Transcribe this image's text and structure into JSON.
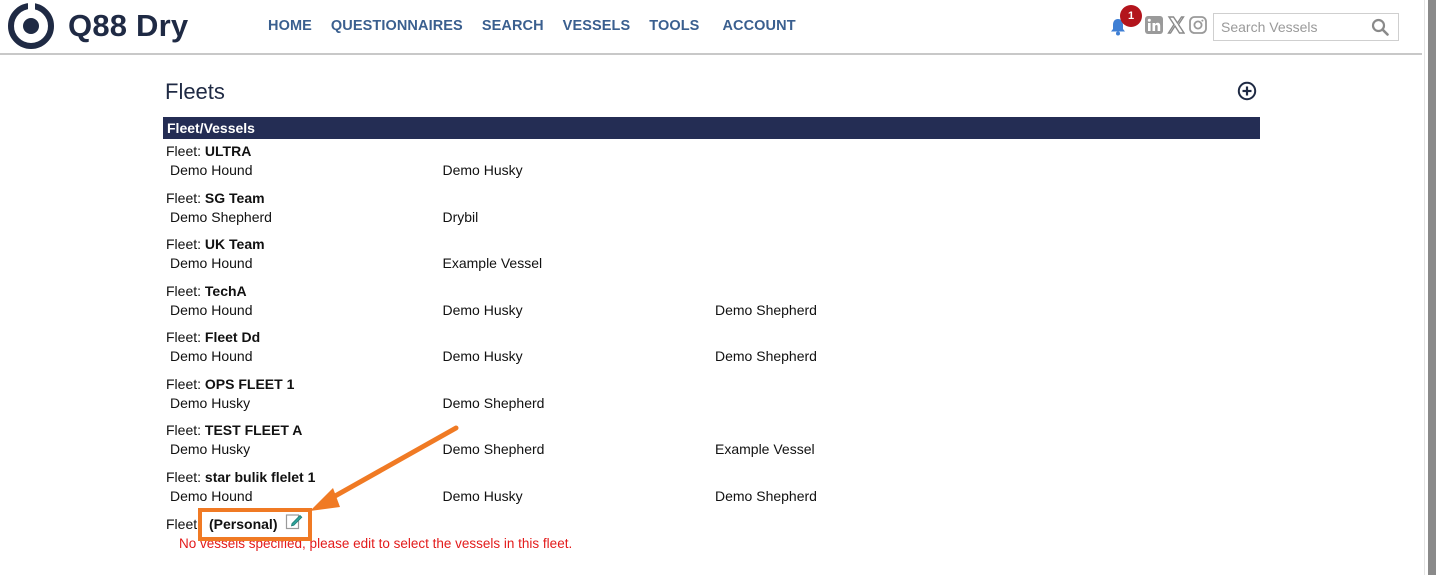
{
  "brand": {
    "name": "Q88 Dry"
  },
  "nav": {
    "items": [
      "HOME",
      "QUESTIONNAIRES",
      "SEARCH",
      "VESSELS",
      "TOOLS",
      "ACCOUNT"
    ]
  },
  "notifications": {
    "count": "1"
  },
  "search": {
    "placeholder": "Search Vessels"
  },
  "page": {
    "title": "Fleets",
    "table_header": "Fleet/Vessels"
  },
  "fleet_label": "Fleet:",
  "fleets": [
    {
      "name": "ULTRA",
      "vessels": [
        "Demo Hound",
        "Demo Husky"
      ]
    },
    {
      "name": "SG Team",
      "vessels": [
        "Demo Shepherd",
        "Drybil"
      ]
    },
    {
      "name": "UK Team",
      "vessels": [
        "Demo Hound",
        "Example Vessel"
      ]
    },
    {
      "name": "TechA",
      "vessels": [
        "Demo Hound",
        "Demo Husky",
        "Demo Shepherd"
      ]
    },
    {
      "name": "Fleet Dd",
      "vessels": [
        "Demo Hound",
        "Demo Husky",
        "Demo Shepherd"
      ]
    },
    {
      "name": "OPS FLEET 1",
      "vessels": [
        "Demo Husky",
        "Demo Shepherd"
      ]
    },
    {
      "name": "TEST FLEET A",
      "vessels": [
        "Demo Husky",
        "Demo Shepherd",
        "Example Vessel"
      ]
    },
    {
      "name": "star bulik flelet 1",
      "vessels": [
        "Demo Hound",
        "Demo Husky",
        "Demo Shepherd"
      ]
    }
  ],
  "personal_fleet": {
    "label": "Fleet:",
    "name": "(Personal)",
    "message": "No vessels specified, please edit to select the vessels in this fleet."
  },
  "colors": {
    "nav": "#3a5f8f",
    "header_bar": "#242d54",
    "badge": "#b3141c",
    "highlight": "#f07a24",
    "error_text": "#e31b1b"
  },
  "icons": [
    "bell-icon",
    "linkedin-icon",
    "x-icon",
    "instagram-icon",
    "search-icon",
    "add-circle-icon",
    "edit-icon"
  ]
}
